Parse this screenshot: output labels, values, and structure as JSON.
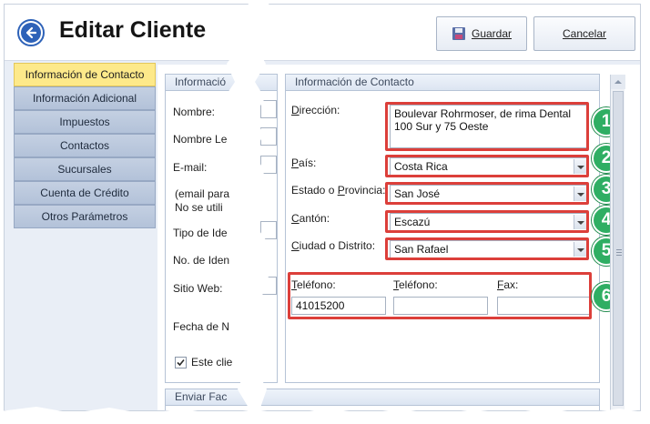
{
  "header": {
    "title": "Editar Cliente",
    "save_label": "Guardar",
    "cancel_label": "Cancelar",
    "save_icon": "save-disk-icon",
    "back_icon": "back-arrow-icon"
  },
  "sidebar": {
    "items": [
      {
        "label": "Información de Contacto",
        "active": true
      },
      {
        "label": "Información Adicional",
        "active": false
      },
      {
        "label": "Impuestos",
        "active": false
      },
      {
        "label": "Contactos",
        "active": false
      },
      {
        "label": "Sucursales",
        "active": false
      },
      {
        "label": "Cuenta de Crédito",
        "active": false
      },
      {
        "label": "Otros Parámetros",
        "active": false
      }
    ]
  },
  "left_panel": {
    "title": "Informació",
    "fields": [
      {
        "label": "Nombre:"
      },
      {
        "label": "Nombre Le"
      },
      {
        "label": "E-mail:"
      },
      {
        "label": "(email para"
      },
      {
        "label": "No se utili"
      },
      {
        "label": "Tipo de Ide"
      },
      {
        "label": "No. de Iden"
      },
      {
        "label": "Sitio Web:"
      },
      {
        "label": "Fecha de N"
      }
    ],
    "checkbox_label": "Este clie",
    "checkbox_checked": true
  },
  "bottom_panel": {
    "title": "Enviar Fac"
  },
  "right_panel": {
    "title": "Información de Contacto",
    "direccion": {
      "label": "Dirección:",
      "value": "Boulevar Rohrmoser, de rima Dental\n100 Sur y 75 Oeste"
    },
    "pais": {
      "label": "País:",
      "value": "Costa Rica"
    },
    "provincia": {
      "label": "Estado o Provincia:",
      "value": "San José"
    },
    "canton": {
      "label": "Cantón:",
      "value": "Escazú"
    },
    "distrito": {
      "label": "Ciudad o Distrito:",
      "value": "San Rafael"
    },
    "telefono1": {
      "label": "Teléfono:",
      "value": "41015200"
    },
    "telefono2": {
      "label": "Teléfono:",
      "value": ""
    },
    "fax": {
      "label": "Fax:",
      "value": ""
    }
  },
  "callouts": [
    "1",
    "2",
    "3",
    "4",
    "5",
    "6"
  ],
  "colors": {
    "accent_blue": "#2e62b8",
    "active_tab": "#fde98a",
    "callout_red": "#dc3f3a",
    "badge_green": "#2fae63"
  }
}
